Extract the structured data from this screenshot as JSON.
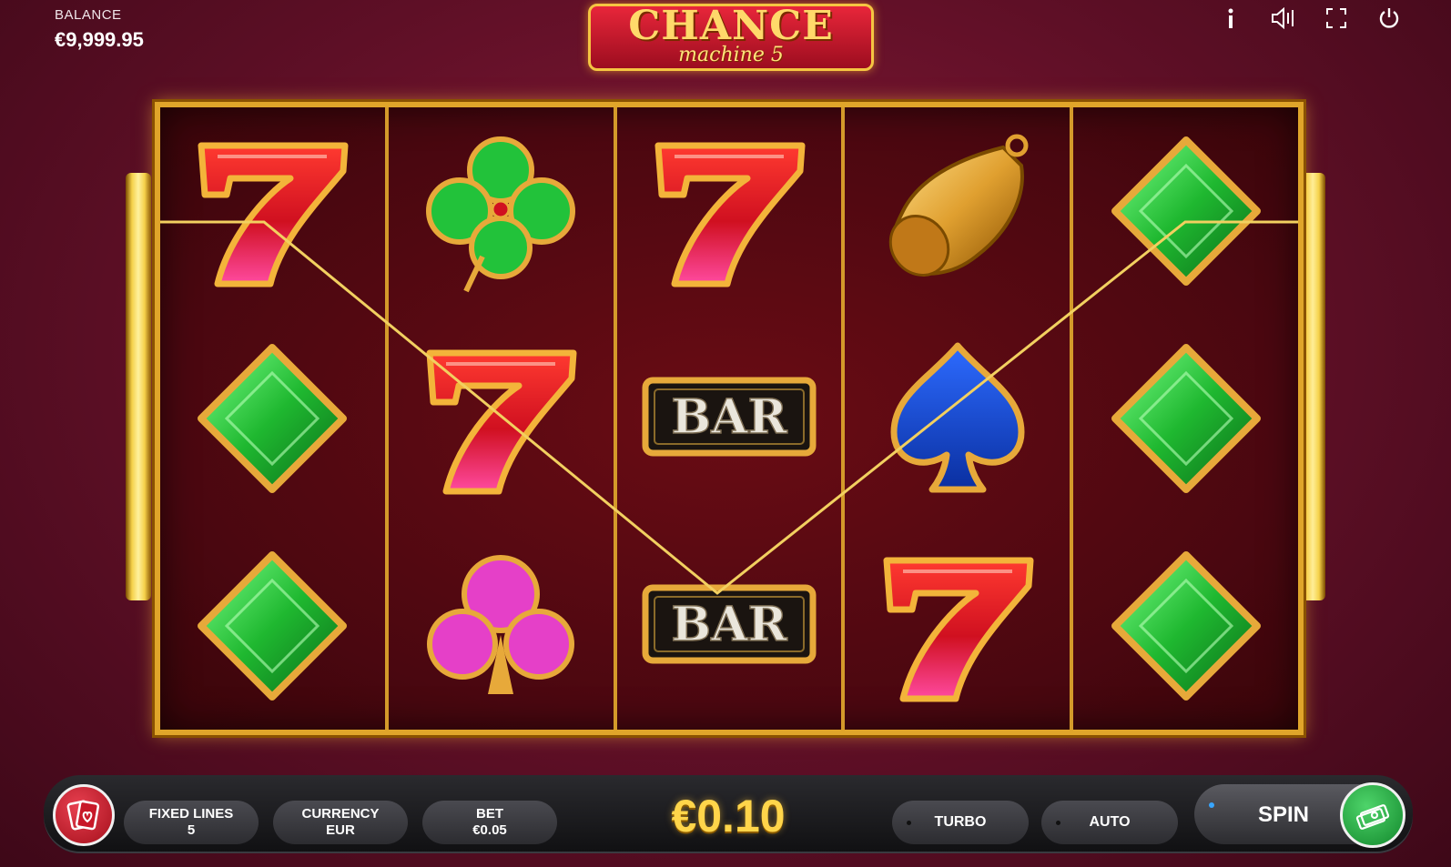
{
  "balance": {
    "label": "BALANCE",
    "value": "€9,999.95"
  },
  "logo": {
    "title": "CHANCE",
    "subtitle": "machine 5"
  },
  "top_icons": [
    "info-icon",
    "sound-icon",
    "fullscreen-icon",
    "power-icon"
  ],
  "reels": [
    [
      "seven",
      "diamond",
      "diamond"
    ],
    [
      "clover",
      "seven",
      "club"
    ],
    [
      "seven",
      "bar",
      "bar"
    ],
    [
      "bell",
      "spade",
      "seven"
    ],
    [
      "diamond",
      "diamond",
      "diamond"
    ]
  ],
  "bar_label": "BAR",
  "panel": {
    "fixed_lines": {
      "label": "FIXED LINES",
      "value": "5"
    },
    "currency": {
      "label": "CURRENCY",
      "value": "EUR"
    },
    "bet": {
      "label": "BET",
      "value": "€0.05"
    },
    "win_amount": "€0.10",
    "turbo_label": "TURBO",
    "auto_label": "AUTO",
    "spin_label": "SPIN"
  },
  "colors": {
    "accent": "#ffd54a",
    "background": "#6a1230",
    "spin_green": "#1fa23c",
    "heart_red": "#d82030"
  }
}
